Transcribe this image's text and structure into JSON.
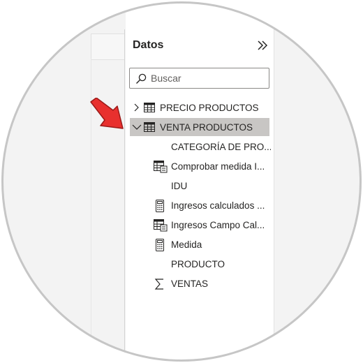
{
  "panel": {
    "title": "Datos"
  },
  "search": {
    "placeholder": "Buscar"
  },
  "tables": [
    {
      "label": "PRECIO PRODUCTOS",
      "expanded": false,
      "selected": false
    },
    {
      "label": "VENTA PRODUCTOS",
      "expanded": true,
      "selected": true
    }
  ],
  "fields": [
    {
      "label": "CATEGORÍA DE PRO...",
      "icon": "none"
    },
    {
      "label": "Comprobar medida I...",
      "icon": "calculated-table-icon"
    },
    {
      "label": "IDU",
      "icon": "none"
    },
    {
      "label": "Ingresos calculados ...",
      "icon": "calculator-icon"
    },
    {
      "label": "Ingresos Campo Cal...",
      "icon": "calculated-table-icon"
    },
    {
      "label": "Medida",
      "icon": "calculator-icon"
    },
    {
      "label": "PRODUCTO",
      "icon": "none"
    },
    {
      "label": "VENTAS",
      "icon": "sigma-icon"
    }
  ],
  "colors": {
    "arrow": "#e8302e",
    "selected_row": "#c8c6c4",
    "ring": "#c6c6c6"
  }
}
